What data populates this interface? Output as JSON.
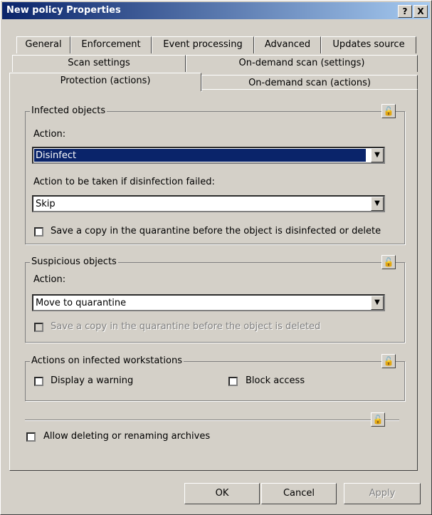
{
  "window": {
    "title": "New policy Properties"
  },
  "titlebar_buttons": {
    "help": "?",
    "close": "X"
  },
  "tabs": {
    "row1": [
      "General",
      "Enforcement",
      "Event processing",
      "Advanced",
      "Updates source"
    ],
    "row2": [
      "Scan settings",
      "On-demand scan (settings)"
    ],
    "row3": [
      "Protection (actions)",
      "On-demand scan (actions)"
    ],
    "active": "Protection (actions)"
  },
  "infected": {
    "group_label": "Infected objects",
    "action_label": "Action:",
    "action_value": "Disinfect",
    "fail_label": "Action to be taken if disinfection failed:",
    "fail_value": "Skip",
    "save_copy_label": "Save a copy in the quarantine before the object is disinfected or delete",
    "save_copy_checked": false
  },
  "suspicious": {
    "group_label": "Suspicious objects",
    "action_label": "Action:",
    "action_value": "Move to quarantine",
    "save_copy_label": "Save a copy in the quarantine before the object is  deleted",
    "save_copy_checked": false,
    "save_copy_enabled": false
  },
  "workstations": {
    "group_label": "Actions on infected workstations",
    "warning_label": "Display a warning",
    "block_label": "Block access"
  },
  "archives": {
    "label": "Allow deleting or renaming archives"
  },
  "buttons": {
    "ok": "OK",
    "cancel": "Cancel",
    "apply": "Apply"
  },
  "icons": {
    "lock": "lock-icon",
    "dropdown": "chevron-down-icon"
  }
}
